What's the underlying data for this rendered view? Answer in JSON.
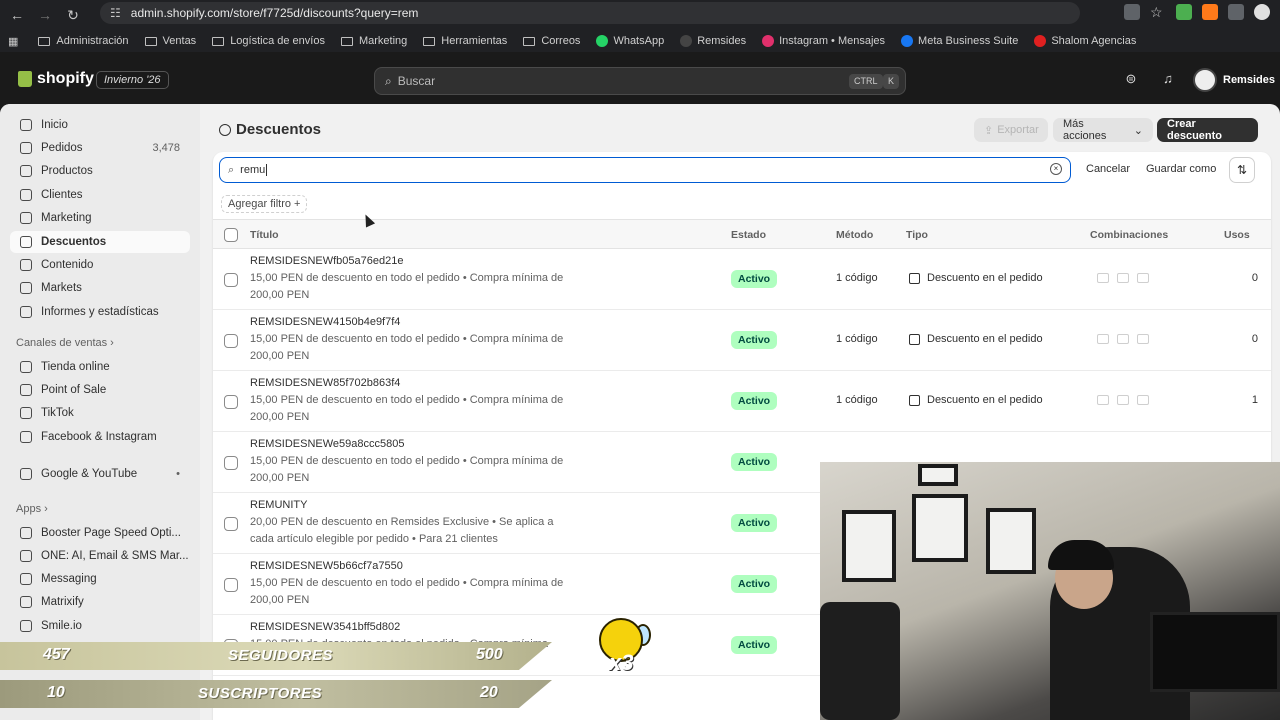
{
  "browser": {
    "url": "admin.shopify.com/store/f7725d/discounts?query=rem",
    "bookmarks": [
      "Administración",
      "Ventas",
      "Logística de envíos",
      "Marketing",
      "Herramientas",
      "Correos",
      "WhatsApp",
      "Remsides",
      "Instagram • Mensajes",
      "Meta Business Suite",
      "Shalom Agencias"
    ]
  },
  "header": {
    "brand": "shopify",
    "edition": "Invierno '26",
    "search_placeholder": "Buscar",
    "kbd_ctrl": "CTRL",
    "kbd_k": "K",
    "store_name": "Remsides"
  },
  "sidebar": {
    "items": [
      {
        "label": "Inicio"
      },
      {
        "label": "Pedidos",
        "count": "3,478"
      },
      {
        "label": "Productos"
      },
      {
        "label": "Clientes"
      },
      {
        "label": "Marketing"
      },
      {
        "label": "Descuentos"
      },
      {
        "label": "Contenido"
      },
      {
        "label": "Markets"
      },
      {
        "label": "Informes y estadísticas"
      }
    ],
    "channels_heading": "Canales de ventas",
    "channels": [
      {
        "label": "Tienda online"
      },
      {
        "label": "Point of Sale"
      },
      {
        "label": "TikTok"
      },
      {
        "label": "Facebook & Instagram"
      },
      {
        "label": "Google & YouTube"
      }
    ],
    "apps_heading": "Apps",
    "apps": [
      {
        "label": "Booster Page Speed Opti..."
      },
      {
        "label": "ONE: AI, Email & SMS Mar..."
      },
      {
        "label": "Messaging"
      },
      {
        "label": "Matrixify"
      },
      {
        "label": "Smile.io"
      }
    ]
  },
  "page": {
    "title": "Descuentos",
    "export_label": "Exportar",
    "more_actions_label": "Más acciones",
    "create_label": "Crear descuento",
    "filter_value": "remu",
    "cancel_label": "Cancelar",
    "save_as_label": "Guardar como",
    "add_filter_label": "Agregar filtro +"
  },
  "table": {
    "columns": [
      "Título",
      "Estado",
      "Método",
      "Tipo",
      "Combinaciones",
      "Usos"
    ],
    "rows": [
      {
        "title": "REMSIDESNEWfb05a76ed21e",
        "desc": "15,00 PEN de descuento en todo el pedido • Compra mínima de 200,00 PEN",
        "status": "Activo",
        "method": "1 código",
        "type": "Descuento en el pedido",
        "uses": "0"
      },
      {
        "title": "REMSIDESNEW4150b4e9f7f4",
        "desc": "15,00 PEN de descuento en todo el pedido • Compra mínima de 200,00 PEN",
        "status": "Activo",
        "method": "1 código",
        "type": "Descuento en el pedido",
        "uses": "0"
      },
      {
        "title": "REMSIDESNEW85f702b863f4",
        "desc": "15,00 PEN de descuento en todo el pedido • Compra mínima de 200,00 PEN",
        "status": "Activo",
        "method": "1 código",
        "type": "Descuento en el pedido",
        "uses": "1"
      },
      {
        "title": "REMSIDESNEWe59a8ccc5805",
        "desc": "15,00 PEN de descuento en todo el pedido • Compra mínima de 200,00 PEN",
        "status": "Activo",
        "method": "",
        "type": "",
        "uses": ""
      },
      {
        "title": "REMUNITY",
        "desc": "20,00 PEN de descuento en Remsides Exclusive • Se aplica a cada artículo elegible por pedido • Para 21 clientes",
        "status": "Activo",
        "method": "",
        "type": "",
        "uses": ""
      },
      {
        "title": "REMSIDESNEW5b66cf7a7550",
        "desc": "15,00 PEN de descuento en todo el pedido • Compra mínima de 200,00 PEN",
        "status": "Activo",
        "method": "",
        "type": "",
        "uses": ""
      },
      {
        "title": "REMSIDESNEW3541bff5d802",
        "desc": "15,00 PEN de descuento en todo el pedido • Compra mínima",
        "status": "Activo",
        "method": "",
        "type": "",
        "uses": ""
      }
    ]
  },
  "overlay": {
    "followers_current": "457",
    "followers_label": "SEGUIDORES",
    "followers_goal": "500",
    "subs_current": "10",
    "subs_label": "SUSCRIPTORES",
    "subs_goal": "20",
    "multiplier": "x3"
  }
}
